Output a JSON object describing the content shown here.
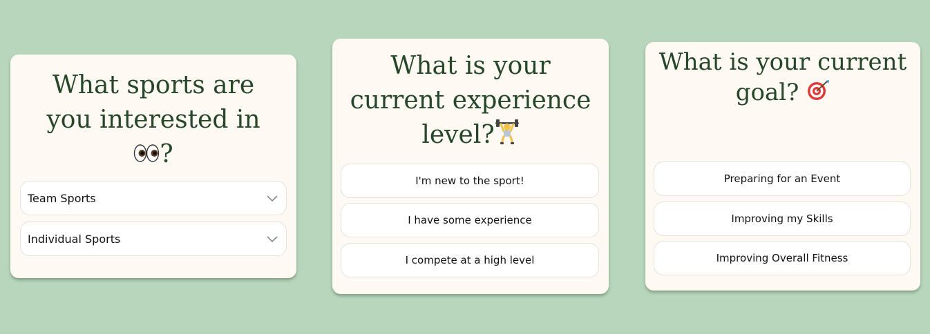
{
  "colors": {
    "background": "#b7d6bb",
    "card": "#fefaf3",
    "title": "#26472a",
    "option_bg": "#ffffff"
  },
  "card_sports": {
    "title_line1": "What sports are",
    "title_line2": "you interested in",
    "title_line3": "?",
    "title_icon": "eyes-icon",
    "dropdowns": [
      {
        "label": "Team Sports",
        "icon": "chevron-down-icon"
      },
      {
        "label": "Individual Sports",
        "icon": "chevron-down-icon"
      }
    ]
  },
  "card_experience": {
    "title_line1": "What is your",
    "title_line2": "current experience",
    "title_line3": "level?",
    "title_icon": "weightlifter-icon",
    "options": [
      {
        "label": "I'm new to the sport!"
      },
      {
        "label": "I have some experience"
      },
      {
        "label": "I compete at a high level"
      }
    ]
  },
  "card_goal": {
    "title_line1": "What is your current",
    "title_line2": "goal?",
    "title_icon": "target-icon",
    "options": [
      {
        "label": "Preparing for an Event"
      },
      {
        "label": "Improving my Skills"
      },
      {
        "label": "Improving Overall Fitness"
      }
    ]
  }
}
